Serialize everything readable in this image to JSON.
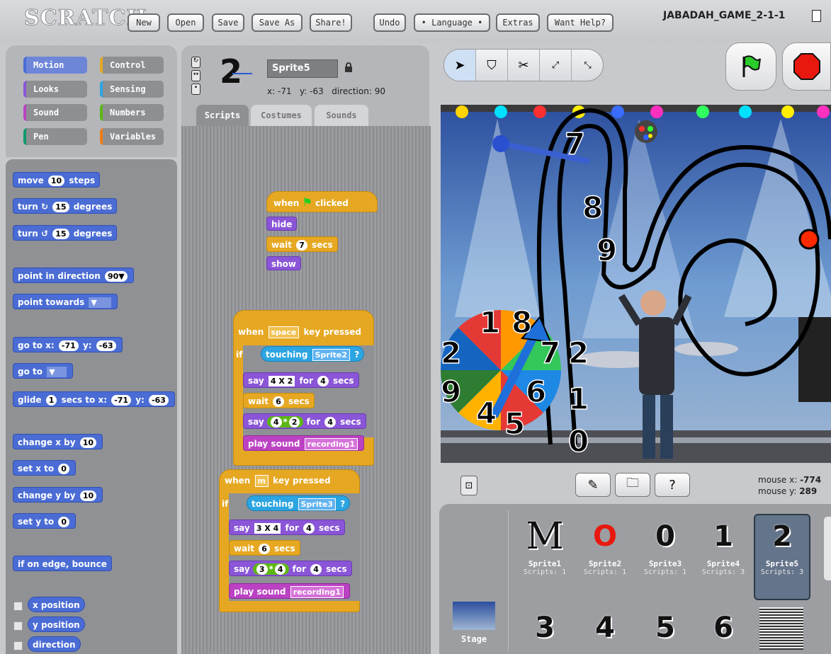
{
  "topbar": {
    "logo": "SCRATCH",
    "buttons": [
      "New",
      "Open",
      "Save",
      "Save As",
      "Share!",
      "Undo",
      "• Language •",
      "Extras",
      "Want Help?"
    ],
    "project_title": "JABADAH_GAME_2-1-1"
  },
  "categories": [
    {
      "label": "Motion",
      "color": "#4a6cd4"
    },
    {
      "label": "Control",
      "color": "#e6a822"
    },
    {
      "label": "Looks",
      "color": "#8a55d7"
    },
    {
      "label": "Sensing",
      "color": "#2ca5e2"
    },
    {
      "label": "Sound",
      "color": "#bb42c3"
    },
    {
      "label": "Numbers",
      "color": "#5cb712"
    },
    {
      "label": "Pen",
      "color": "#0e9a6c"
    },
    {
      "label": "Variables",
      "color": "#ee7d16"
    }
  ],
  "palette": {
    "move": {
      "a": "move",
      "n": "10",
      "b": "steps"
    },
    "turn_cw": {
      "a": "turn",
      "n": "15",
      "b": "degrees"
    },
    "turn_ccw": {
      "a": "turn",
      "n": "15",
      "b": "degrees"
    },
    "point_dir": {
      "a": "point in direction",
      "n": "90▼"
    },
    "point_towards": {
      "a": "point towards"
    },
    "goto_xy": {
      "a": "go to x:",
      "x": "-71",
      "b": "y:",
      "y": "-63"
    },
    "goto": {
      "a": "go to"
    },
    "glide": {
      "a": "glide",
      "n": "1",
      "b": "secs to x:",
      "x": "-71",
      "c": "y:",
      "y": "-63"
    },
    "change_x": {
      "a": "change x by",
      "n": "10"
    },
    "set_x": {
      "a": "set x to",
      "n": "0"
    },
    "change_y": {
      "a": "change y by",
      "n": "10"
    },
    "set_y": {
      "a": "set y to",
      "n": "0"
    },
    "bounce": "if on edge, bounce",
    "reporters": [
      "x position",
      "y position",
      "direction"
    ]
  },
  "sprite": {
    "name": "Sprite5",
    "x_label": "x:",
    "x": "-71",
    "y_label": "y:",
    "y": "-63",
    "dir_label": "direction:",
    "dir": "90",
    "glyph": "2"
  },
  "tabs": [
    "Scripts",
    "Costumes",
    "Sounds"
  ],
  "scripts": {
    "s1": {
      "when": "when",
      "clicked": "clicked",
      "hide": "hide",
      "wait": "wait",
      "wait_n": "7",
      "secs": "secs",
      "show": "show"
    },
    "s2": {
      "when": "when",
      "key": "space",
      "pressed": "key pressed",
      "if": "if",
      "touching": "touching",
      "target": "Sprite2",
      "q": "?",
      "say": "say",
      "say_v": "4 X 2",
      "for": "for",
      "say_n": "4",
      "secs": "secs",
      "wait": "wait",
      "wait_n": "6",
      "say2_a": "4",
      "op": "*",
      "say2_b": "2",
      "say2_n": "4",
      "play": "play sound",
      "snd": "recording1"
    },
    "s3": {
      "when": "when",
      "key": "m",
      "pressed": "key pressed",
      "if": "if",
      "touching": "touching",
      "target": "Sprite3",
      "q": "?",
      "say": "say",
      "say_v": "3 X 4",
      "for": "for",
      "say_n": "4",
      "secs": "secs",
      "wait": "wait",
      "wait_n": "6",
      "say2_a": "3",
      "op": "*",
      "say2_b": "4",
      "say2_n": "4",
      "play": "play sound",
      "snd": "recording1"
    }
  },
  "mouse": {
    "x_label": "mouse x:",
    "x": "-774",
    "y_label": "mouse y:",
    "y": "289"
  },
  "sprites": [
    {
      "name": "Sprite1",
      "scripts": "Scripts: 1",
      "glyph": "M"
    },
    {
      "name": "Sprite2",
      "scripts": "Scripts: 1",
      "glyph": "O"
    },
    {
      "name": "Sprite3",
      "scripts": "Scripts: 1",
      "glyph": "0"
    },
    {
      "name": "Sprite4",
      "scripts": "Scripts: 3",
      "glyph": "1"
    },
    {
      "name": "Sprite5",
      "scripts": "Scripts: 3",
      "glyph": "2"
    }
  ],
  "sprites_row2": [
    "3",
    "4",
    "5",
    "6"
  ],
  "stage_label": "Stage",
  "wheel": [
    "1",
    "8",
    "7",
    "6",
    "5",
    "4",
    "9",
    "2"
  ],
  "board_numbers": [
    "7",
    "8",
    "9",
    "2",
    "1",
    "0"
  ]
}
